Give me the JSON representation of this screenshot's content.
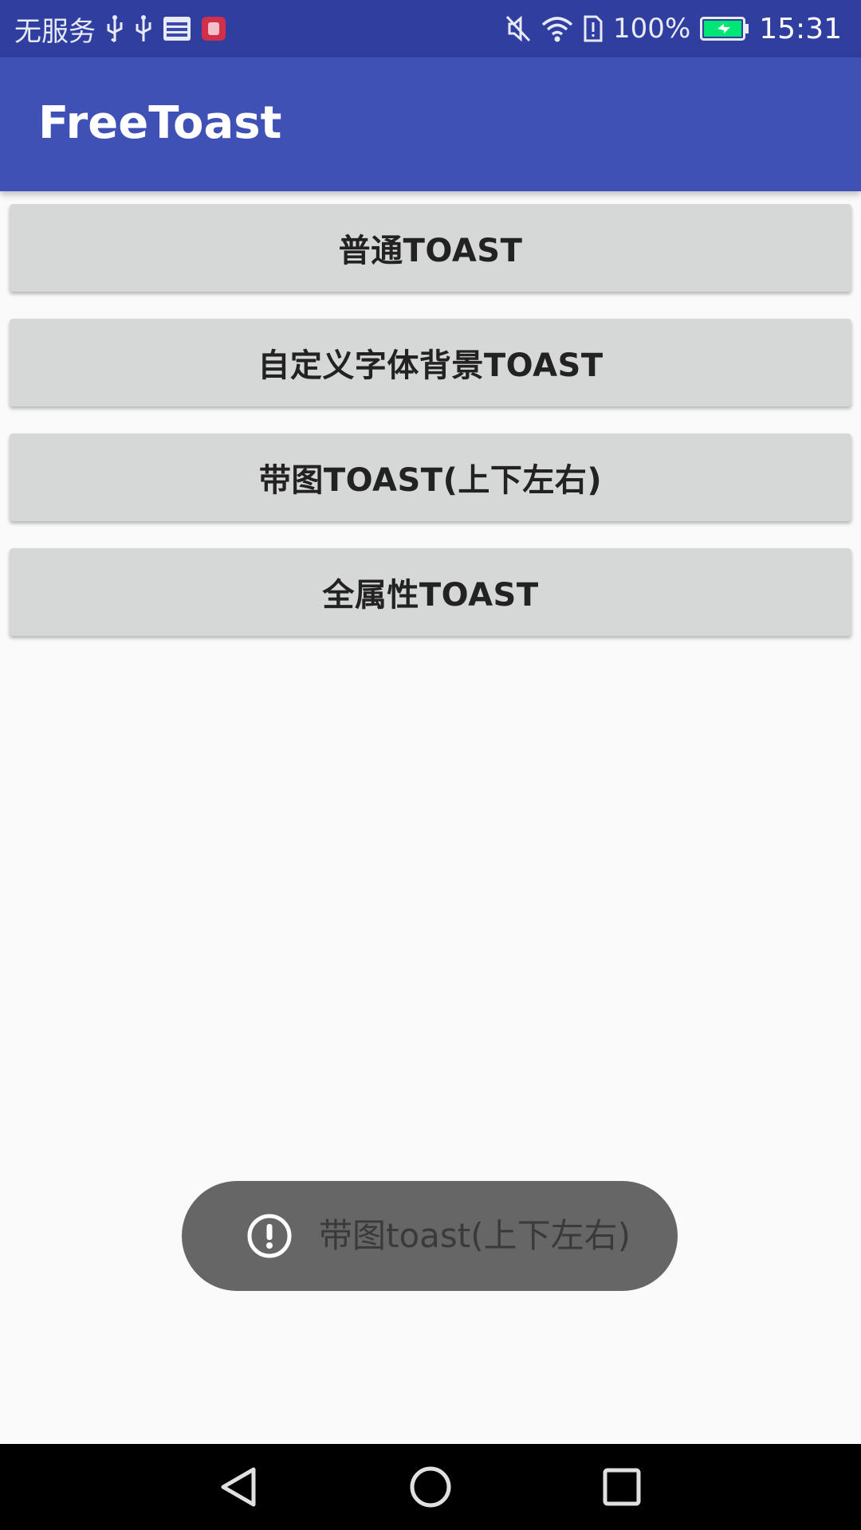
{
  "status_bar": {
    "carrier": "无服务",
    "battery": "100%",
    "time": "15:31",
    "icons": [
      "usb-icon",
      "usb-icon",
      "toutiao-app-icon",
      "app-notification-icon",
      "mute-icon",
      "wifi-icon",
      "sim-alert-icon",
      "battery-charging-icon"
    ]
  },
  "app_bar": {
    "title": "FreeToast"
  },
  "buttons": [
    {
      "label": "普通TOAST"
    },
    {
      "label": "自定义字体背景TOAST"
    },
    {
      "label": "带图TOAST(上下左右)"
    },
    {
      "label": "全属性TOAST"
    }
  ],
  "toast": {
    "text": "带图toast(上下左右)",
    "icon": "exclamation-circle-icon"
  },
  "nav_bar": {
    "icons": [
      "back-icon",
      "home-icon",
      "recents-icon"
    ]
  },
  "colors": {
    "status_bar": "#303f9f",
    "app_bar": "#3f51b5",
    "button": "#d6d7d7",
    "toast": "#666666",
    "battery": "#00e676"
  }
}
